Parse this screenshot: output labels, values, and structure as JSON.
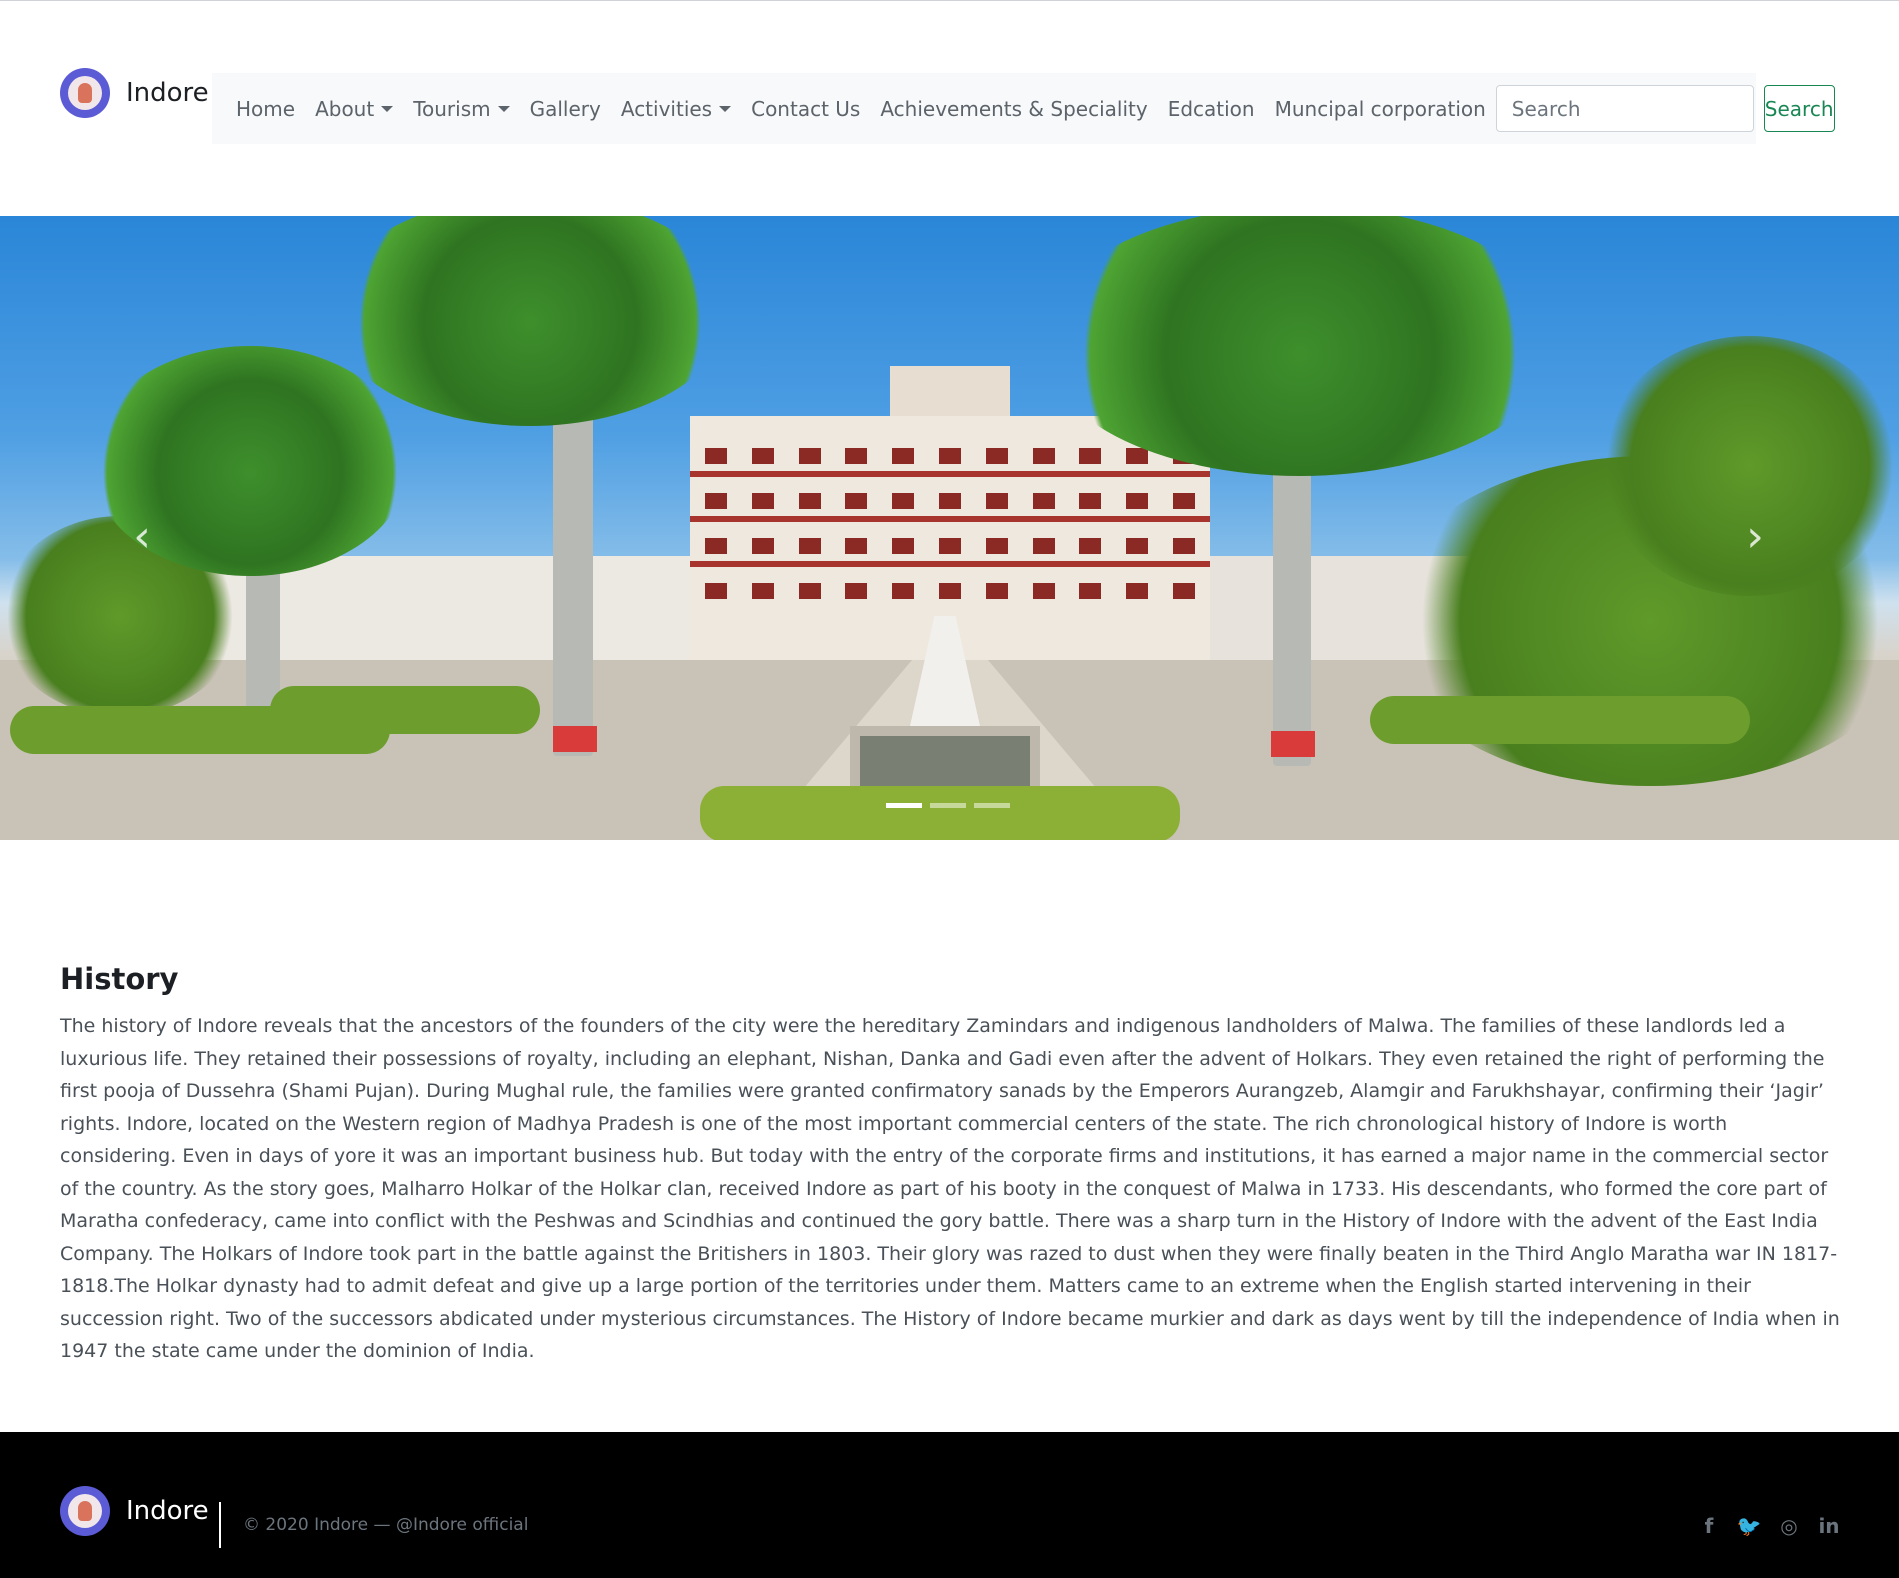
{
  "brand": {
    "name": "Indore"
  },
  "nav": {
    "items": [
      {
        "label": "Home",
        "dropdown": false
      },
      {
        "label": "About",
        "dropdown": true
      },
      {
        "label": "Tourism",
        "dropdown": true
      },
      {
        "label": "Gallery",
        "dropdown": false
      },
      {
        "label": "Activities",
        "dropdown": true
      },
      {
        "label": "Contact Us",
        "dropdown": false
      },
      {
        "label": "Achievements & Speciality",
        "dropdown": false
      },
      {
        "label": "Edcation",
        "dropdown": false
      },
      {
        "label": "Muncipal corporation",
        "dropdown": false
      }
    ],
    "search_placeholder": "Search",
    "search_button": "Search"
  },
  "carousel": {
    "prev_icon": "chevron-left-icon",
    "next_icon": "chevron-right-icon",
    "slide_count": 3,
    "active_slide": 1
  },
  "history": {
    "title": "History",
    "body": "The history of Indore reveals that the ancestors of the founders of the city were the hereditary Zamindars and indigenous landholders of Malwa. The families of these landlords led a luxurious life. They retained their possessions of royalty, including an elephant, Nishan, Danka and Gadi even after the advent of Holkars. They even retained the right of performing the first pooja of Dussehra (Shami Pujan). During Mughal rule, the families were granted confirmatory sanads by the Emperors Aurangzeb, Alamgir and Farukhshayar, confirming their ‘Jagir’ rights. Indore, located on the Western region of Madhya Pradesh is one of the most important commercial centers of the state. The rich chronological history of Indore is worth considering. Even in days of yore it was an important business hub. But today with the entry of the corporate firms and institutions, it has earned a major name in the commercial sector of the country. As the story goes, Malharro Holkar of the Holkar clan, received Indore as part of his booty in the conquest of Malwa in 1733. His descendants, who formed the core part of Maratha confederacy, came into conflict with the Peshwas and Scindhias and continued the gory battle. There was a sharp turn in the History of Indore with the advent of the East India Company. The Holkars of Indore took part in the battle against the Britishers in 1803. Their glory was razed to dust when they were finally beaten in the Third Anglo Maratha war IN 1817- 1818.The Holkar dynasty had to admit defeat and give up a large portion of the territories under them. Matters came to an extreme when the English started intervening in their succession right. Two of the successors abdicated under mysterious circumstances. The History of Indore became murkier and dark as days went by till the independence of India when in 1947 the state came under the dominion of India."
  },
  "footer": {
    "brand": "Indore",
    "copyright": "© 2020 Indore —",
    "handle": "@Indore official",
    "social": [
      {
        "icon": "facebook-icon",
        "glyph": "f"
      },
      {
        "icon": "twitter-icon",
        "glyph": "🐦"
      },
      {
        "icon": "instagram-icon",
        "glyph": "◎"
      },
      {
        "icon": "linkedin-icon",
        "glyph": "in"
      }
    ]
  },
  "colors": {
    "nav_bg": "#f8f9fa",
    "accent_green": "#198754",
    "footer_bg": "#000000",
    "logo_purple": "#5b5bd6"
  }
}
